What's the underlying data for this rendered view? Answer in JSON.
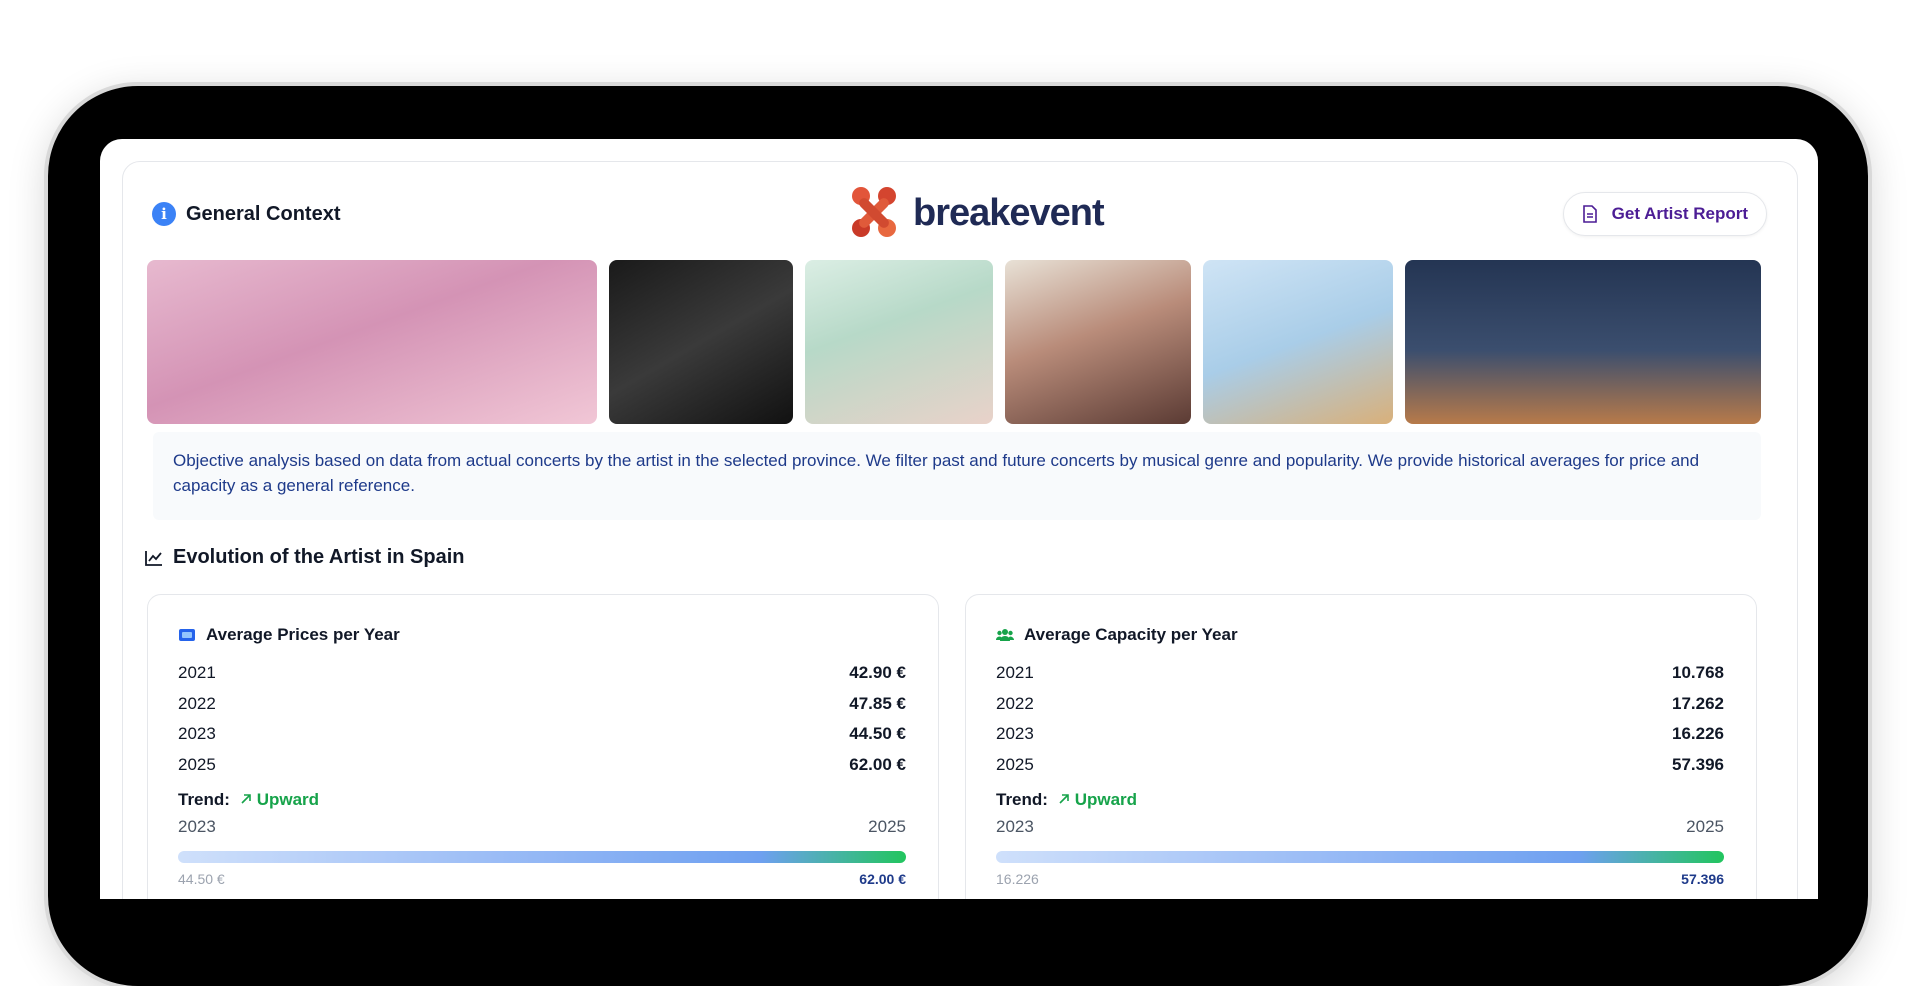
{
  "header": {
    "title": "General Context",
    "brand_name": "breakevent",
    "report_button_label": "Get Artist Report"
  },
  "gallery": {
    "photos": [
      {
        "name": "artist-photo-1",
        "width": 450,
        "bg": "linear-gradient(160deg,#e7b9cf 0%,#d493b5 45%,#f1c7d6 100%)"
      },
      {
        "name": "artist-photo-2",
        "width": 184,
        "bg": "linear-gradient(150deg,#1a1a1a 0%,#3a3a3a 50%,#111 100%)"
      },
      {
        "name": "artist-photo-3",
        "width": 188,
        "bg": "linear-gradient(160deg,#dbeee4 0%,#b7d9c8 40%,#e9d2c9 100%)"
      },
      {
        "name": "artist-photo-4",
        "width": 186,
        "bg": "linear-gradient(160deg,#e8e1d6 0%,#b98c7a 45%,#5b3b34 100%)"
      },
      {
        "name": "artist-photo-5",
        "width": 190,
        "bg": "linear-gradient(160deg,#cfe4f5 0%,#a9cde8 50%,#d9b07a 100%)"
      },
      {
        "name": "artist-photo-6",
        "width": 356,
        "bg": "linear-gradient(180deg,#243553 0%,#3b4e6e 55%,#b77a4a 100%)"
      }
    ]
  },
  "description": "Objective analysis based on data from actual concerts by the artist in the selected province. We filter past and future concerts by musical genre and popularity. We provide historical averages for price and capacity as a general reference.",
  "evolution": {
    "title": "Evolution of the Artist in Spain",
    "prices": {
      "title": "Average Prices per Year",
      "rows": [
        {
          "year": "2021",
          "value": "42.90 €"
        },
        {
          "year": "2022",
          "value": "47.85 €"
        },
        {
          "year": "2023",
          "value": "44.50 €"
        },
        {
          "year": "2025",
          "value": "62.00 €"
        }
      ],
      "trend_label": "Trend:",
      "trend_value": "Upward",
      "range_start": "2023",
      "range_end": "2025",
      "range_low": "44.50 €",
      "range_high": "62.00 €"
    },
    "capacity": {
      "title": "Average Capacity per Year",
      "rows": [
        {
          "year": "2021",
          "value": "10.768"
        },
        {
          "year": "2022",
          "value": "17.262"
        },
        {
          "year": "2023",
          "value": "16.226"
        },
        {
          "year": "2025",
          "value": "57.396"
        }
      ],
      "trend_label": "Trend:",
      "trend_value": "Upward",
      "range_start": "2023",
      "range_end": "2025",
      "range_low": "16.226",
      "range_high": "57.396"
    }
  },
  "colors": {
    "accent_blue": "#3b82f6",
    "trend_green": "#16a34a",
    "brand_orange": "#e2553a",
    "brand_navy": "#1f2a55"
  }
}
